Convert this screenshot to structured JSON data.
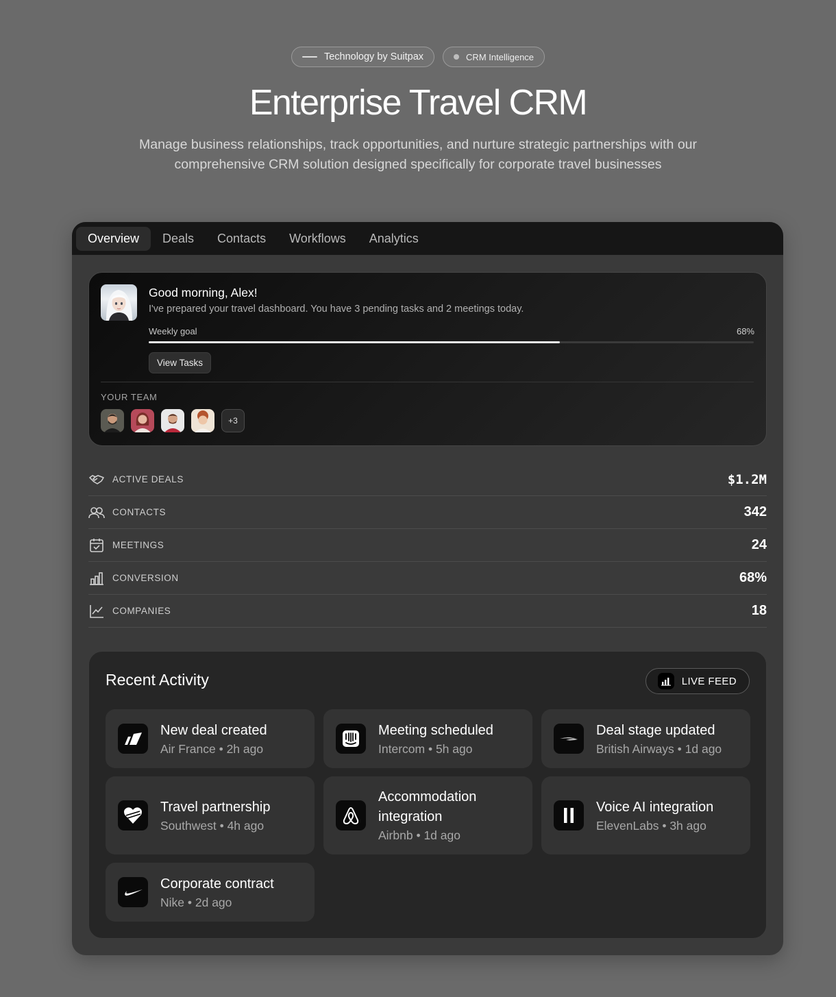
{
  "header": {
    "badge_primary": "Technology by Suitpax",
    "badge_secondary": "CRM Intelligence",
    "title": "Enterprise Travel CRM",
    "subtitle": "Manage business relationships, track opportunities, and nurture strategic partnerships with our comprehensive CRM solution designed specifically for corporate travel businesses"
  },
  "tabs": [
    {
      "label": "Overview",
      "active": true
    },
    {
      "label": "Deals",
      "active": false
    },
    {
      "label": "Contacts",
      "active": false
    },
    {
      "label": "Workflows",
      "active": false
    },
    {
      "label": "Analytics",
      "active": false
    }
  ],
  "welcome": {
    "greeting": "Good morning, Alex!",
    "message": "I've prepared your travel dashboard. You have 3 pending tasks and 2 meetings today.",
    "goal_label": "Weekly goal",
    "goal_percent_text": "68%",
    "goal_fraction": 0.68,
    "button_label": "View Tasks",
    "team_label": "YOUR TEAM",
    "team_more": "+3"
  },
  "stats": [
    {
      "label": "ACTIVE DEALS",
      "value": "$1.2M",
      "icon": "handshake-icon"
    },
    {
      "label": "CONTACTS",
      "value": "342",
      "icon": "users-icon"
    },
    {
      "label": "MEETINGS",
      "value": "24",
      "icon": "calendar-check-icon"
    },
    {
      "label": "CONVERSION",
      "value": "68%",
      "icon": "bar-chart-icon"
    },
    {
      "label": "COMPANIES",
      "value": "18",
      "icon": "line-chart-icon"
    }
  ],
  "activity": {
    "title": "Recent Activity",
    "live_label": "LIVE FEED",
    "items": [
      {
        "title": "New deal created",
        "company": "Air France",
        "time": "2h ago",
        "logo": "air-france-logo-icon"
      },
      {
        "title": "Meeting scheduled",
        "company": "Intercom",
        "time": "5h ago",
        "logo": "intercom-logo-icon"
      },
      {
        "title": "Deal stage updated",
        "company": "British Airways",
        "time": "1d ago",
        "logo": "british-airways-logo-icon"
      },
      {
        "title": "Travel partnership",
        "company": "Southwest",
        "time": "4h ago",
        "logo": "southwest-logo-icon"
      },
      {
        "title": "Accommodation integration",
        "company": "Airbnb",
        "time": "1d ago",
        "logo": "airbnb-logo-icon"
      },
      {
        "title": "Voice AI integration",
        "company": "ElevenLabs",
        "time": "3h ago",
        "logo": "elevenlabs-logo-icon"
      },
      {
        "title": "Corporate contract",
        "company": "Nike",
        "time": "2d ago",
        "logo": "nike-logo-icon"
      }
    ]
  }
}
